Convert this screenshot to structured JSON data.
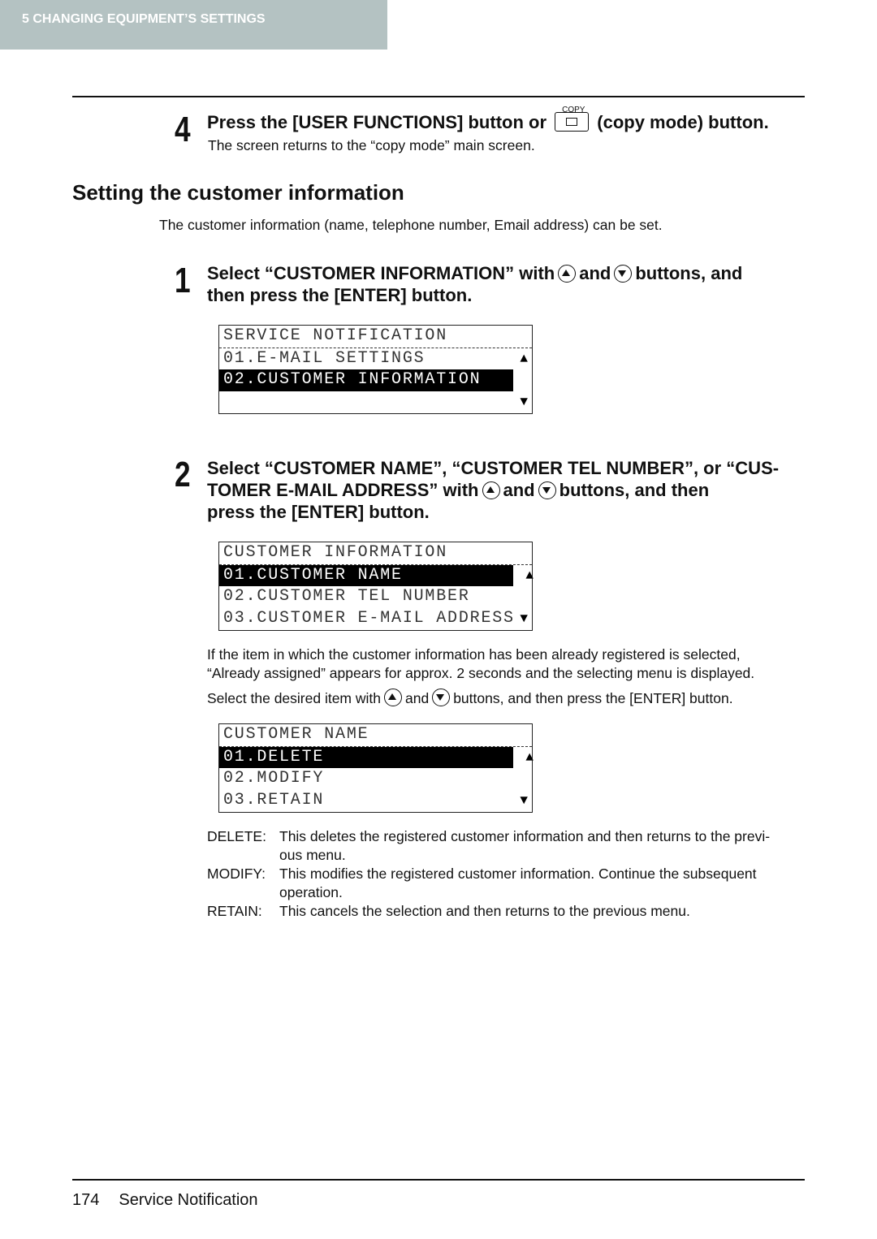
{
  "header": {
    "chapter": "5   CHANGING EQUIPMENT’S SETTINGS"
  },
  "step4": {
    "num": "4",
    "title_a": "Press the [USER FUNCTIONS] button or",
    "copy_label": "COPY",
    "title_b": "(copy mode) button.",
    "text": "The screen returns to the “copy mode” main screen."
  },
  "section": {
    "title": "Setting the customer information",
    "intro": "The customer information (name, telephone number, Email address) can be set."
  },
  "step1": {
    "num": "1",
    "title_a": "Select “CUSTOMER INFORMATION” with",
    "and": "and",
    "title_b": "buttons, and",
    "title_c": "then press the [ENTER] button."
  },
  "lcd1": {
    "title": "SERVICE NOTIFICATION",
    "rows": [
      "01.E-MAIL SETTINGS",
      "02.CUSTOMER INFORMATION",
      ""
    ]
  },
  "step2": {
    "num": "2",
    "line1": "Select “CUSTOMER NAME”, “CUSTOMER TEL NUMBER”, or “CUS-",
    "line2a": "TOMER E-MAIL ADDRESS” with",
    "and": "and",
    "line2b": "buttons, and then",
    "line3": "press the [ENTER] button."
  },
  "lcd2": {
    "title": "CUSTOMER INFORMATION",
    "rows": [
      "01.CUSTOMER NAME",
      "02.CUSTOMER TEL NUMBER",
      "03.CUSTOMER E-MAIL ADDRESS"
    ]
  },
  "note": {
    "p1a": "If the item in which the customer information has been already registered is selected,",
    "p1b": "“Already assigned” appears for approx. 2 seconds and the selecting menu is displayed.",
    "p2a": "Select the desired item with",
    "and": "and",
    "p2b": "buttons, and then press the [ENTER] button."
  },
  "lcd3": {
    "title": "CUSTOMER NAME",
    "rows": [
      "01.DELETE",
      "02.MODIFY",
      "03.RETAIN"
    ]
  },
  "defs": [
    {
      "term": "DELETE:",
      "desc1": "This deletes the registered customer information and then returns to the previ-",
      "desc2": "ous menu."
    },
    {
      "term": "MODIFY:",
      "desc1": "This modifies the registered customer information. Continue the subsequent",
      "desc2": "operation."
    },
    {
      "term": "RETAIN:",
      "desc1": "This cancels the selection and then returns to the previous menu.",
      "desc2": ""
    }
  ],
  "footer": {
    "page": "174",
    "title": "Service Notification"
  }
}
